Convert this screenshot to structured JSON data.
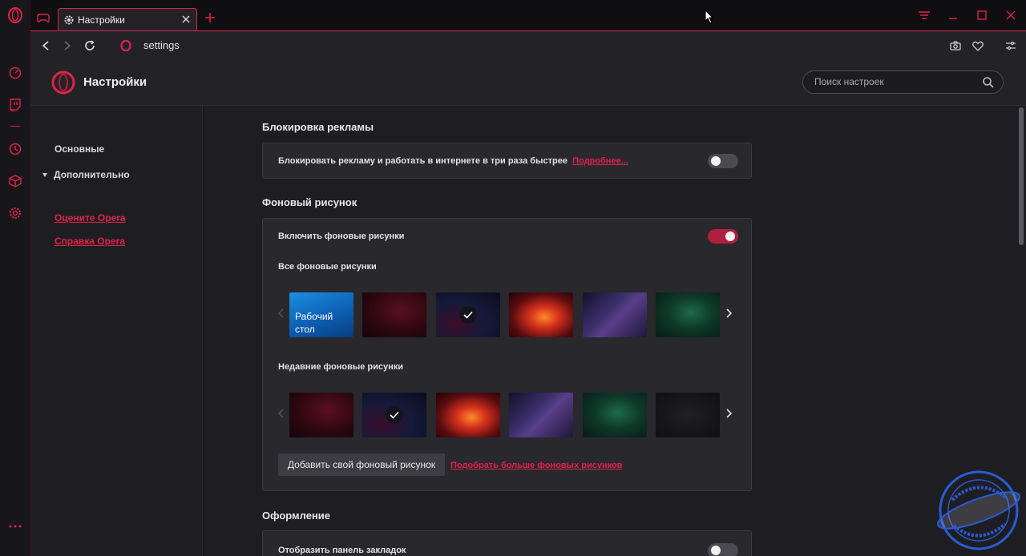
{
  "tab": {
    "title": "Настройки"
  },
  "address": {
    "url": "settings"
  },
  "header": {
    "title": "Настройки",
    "search_placeholder": "Поиск настроек"
  },
  "nav": {
    "basic": "Основные",
    "advanced": "Дополнительно",
    "rate": "Оцените Opera",
    "help": "Справка Opera"
  },
  "adblock": {
    "section_title": "Блокировка рекламы",
    "label": "Блокировать рекламу и работать в интернете в три раза быстрее",
    "link": "Подробнее...",
    "enabled": false
  },
  "wallpaper": {
    "section_title": "Фоновый рисунок",
    "enable_label": "Включить фоновые рисунки",
    "enabled": true,
    "all_label": "Все фоновые рисунки",
    "desktop_thumb_label": "Рабочий стол",
    "recent_label": "Недавние фоновые рисунки",
    "add_button": "Добавить свой фоновый рисунок",
    "more_link": "Подобрать больше фоновых рисунков"
  },
  "appearance": {
    "section_title": "Оформление",
    "bookmarks_label": "Отобразить панель закладок",
    "bookmarks_enabled": false
  },
  "colors": {
    "accent": "#e0224a",
    "background": "#1e1e22",
    "card": "#28282d"
  }
}
